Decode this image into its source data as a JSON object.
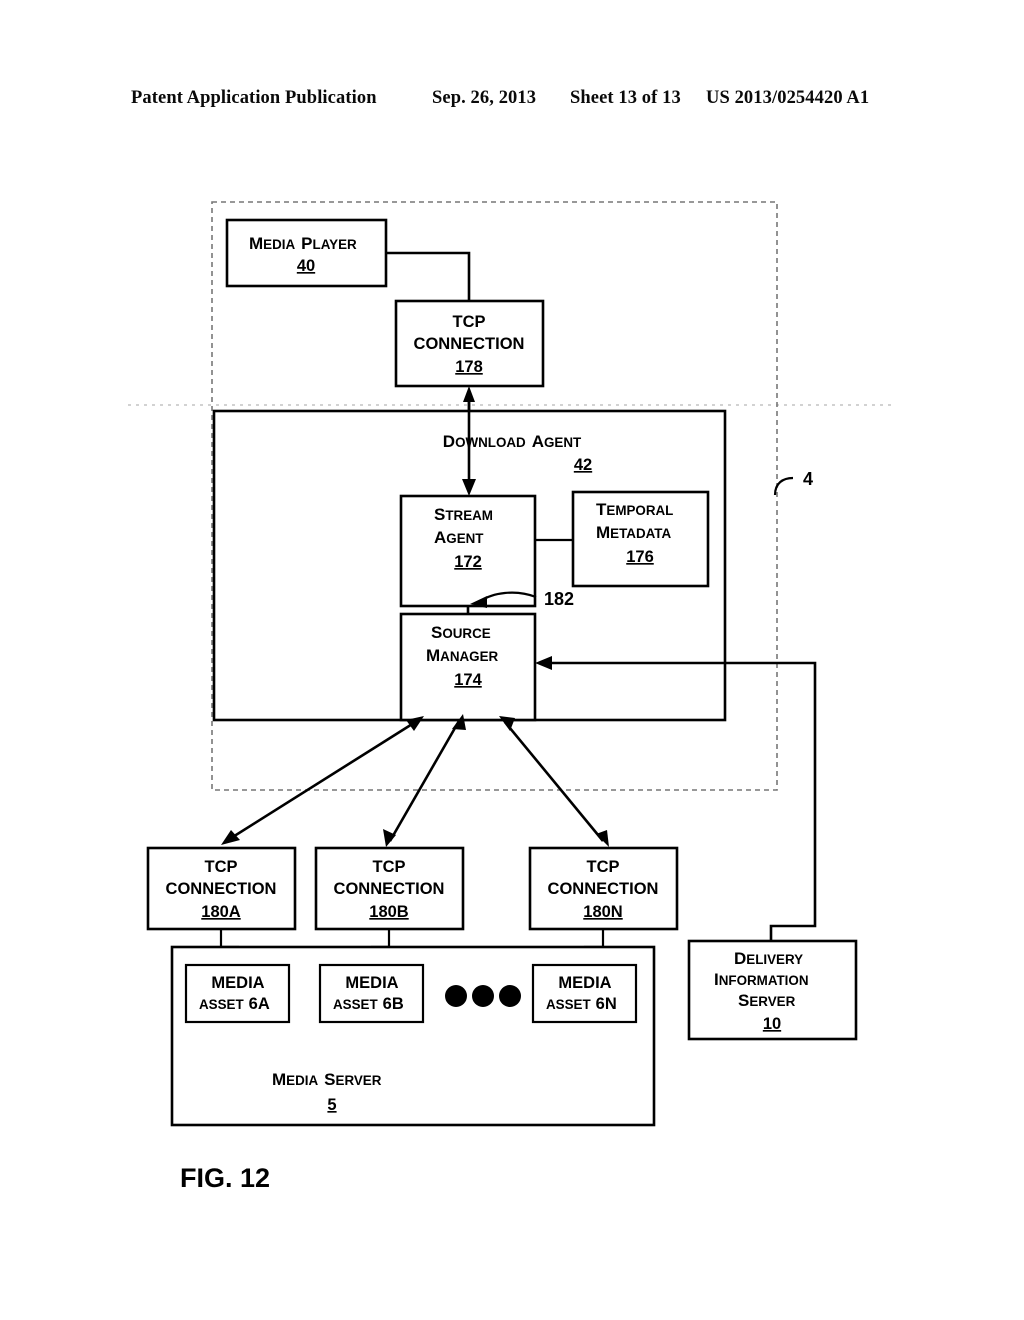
{
  "header": {
    "publication": "Patent Application Publication",
    "date": "Sep. 26, 2013",
    "sheet": "Sheet 13 of 13",
    "patent_number": "US 2013/0254420 A1"
  },
  "figure": {
    "label": "FIG. 12",
    "system_reference": "4"
  },
  "blocks": {
    "media_player": {
      "line1": "MEDIA PLAYER",
      "ref": "40"
    },
    "tcp_178": {
      "line1": "TCP",
      "line2": "CONNECTION",
      "ref": "178"
    },
    "download_agent": {
      "line1": "DOWNLOAD AGENT",
      "ref": "42"
    },
    "stream_agent": {
      "line1": "STREAM",
      "line2": "AGENT",
      "ref": "172"
    },
    "temporal_metadata": {
      "line1": "TEMPORAL",
      "line2": "METADATA",
      "ref": "176"
    },
    "source_manager": {
      "line1": "SOURCE",
      "line2": "MANAGER",
      "ref": "174"
    },
    "tcp_180a": {
      "line1": "TCP",
      "line2": "CONNECTION",
      "ref": "180A"
    },
    "tcp_180b": {
      "line1": "TCP",
      "line2": "CONNECTION",
      "ref": "180B"
    },
    "tcp_180n": {
      "line1": "TCP",
      "line2": "CONNECTION",
      "ref": "180N"
    },
    "media_asset_a": {
      "line1": "MEDIA",
      "line2": "ASSET 6A"
    },
    "media_asset_b": {
      "line1": "MEDIA",
      "line2": "ASSET 6B"
    },
    "media_asset_n": {
      "line1": "MEDIA",
      "line2": "ASSET 6N"
    },
    "media_server": {
      "line1": "MEDIA SERVER",
      "ref": "5"
    },
    "delivery_information_server": {
      "line1": "DELIVERY",
      "line2": "INFORMATION",
      "line3": "SERVER",
      "ref": "10"
    }
  },
  "connectors": {
    "metadata_link_ref": "182"
  },
  "colors": {
    "ink": "#000000",
    "paper": "#ffffff",
    "dashed_boundary": "#777777"
  }
}
